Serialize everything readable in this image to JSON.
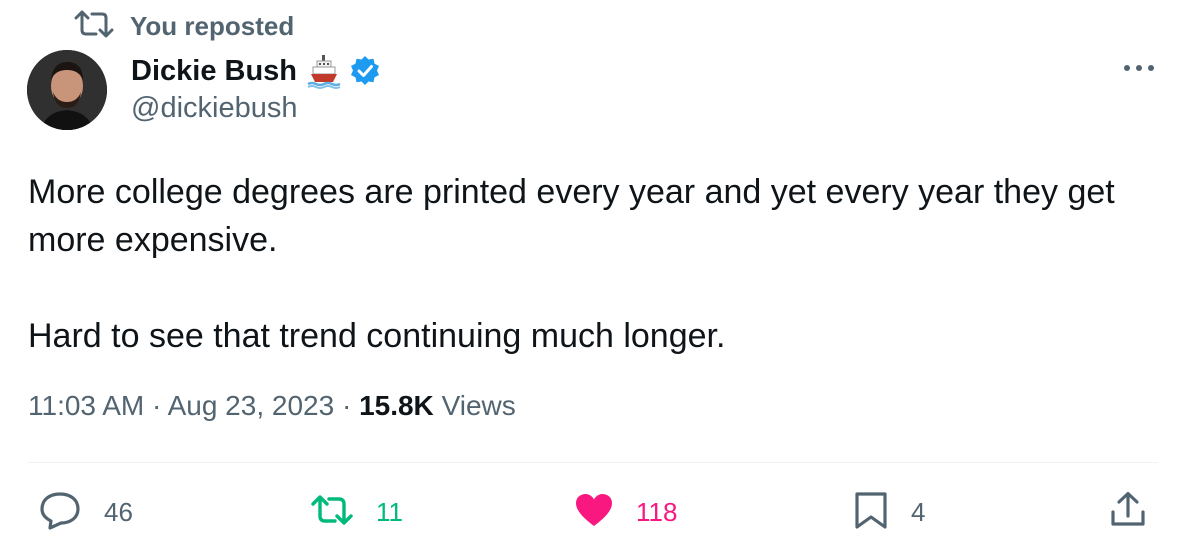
{
  "repost": {
    "label": "You reposted",
    "icon": "repost-icon"
  },
  "author": {
    "name": "Dickie Bush",
    "name_emoji": "ship-emoji",
    "verified": true,
    "handle": "@dickiebush"
  },
  "tweet": {
    "paragraphs": [
      "More college degrees are printed every year and yet every year they get more expensive.",
      "Hard to see that trend continuing much longer."
    ],
    "time": "11:03 AM",
    "date": "Aug 23, 2023",
    "separator": "·",
    "views_count": "15.8K",
    "views_label": "Views"
  },
  "actions": {
    "replies": "46",
    "reposts": "11",
    "likes": "118",
    "bookmarks": "4"
  },
  "colors": {
    "muted": "#536471",
    "text": "#0f1419",
    "repost_active": "#00ba7c",
    "like_active": "#f91880",
    "verified_blue": "#1d9bf0"
  }
}
